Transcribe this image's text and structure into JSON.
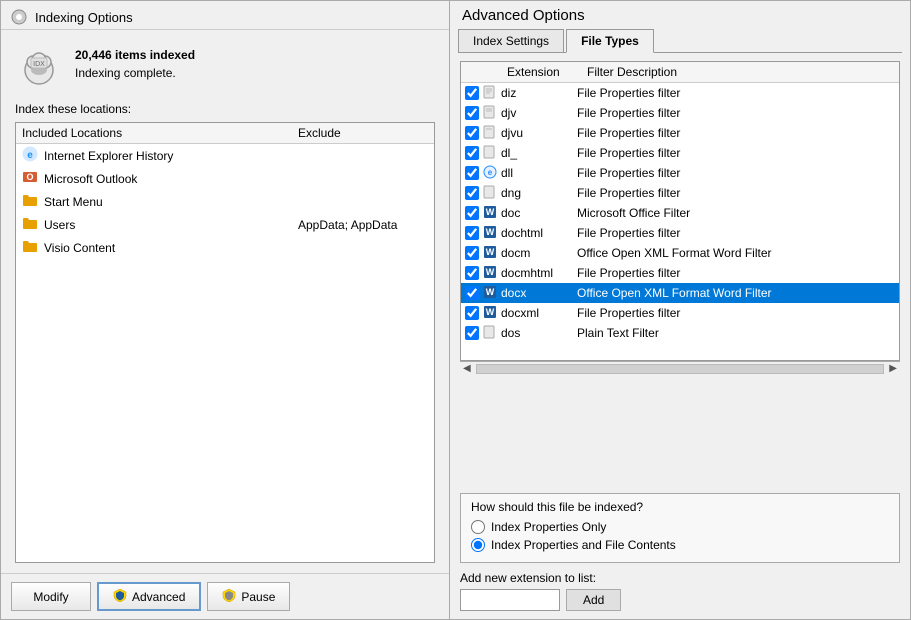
{
  "left": {
    "title": "Indexing Options",
    "items_indexed": "20,446 items indexed",
    "indexing_status": "Indexing complete.",
    "index_locations_label": "Index these locations:",
    "locations_header": {
      "col1": "Included Locations",
      "col2": "Exclude"
    },
    "locations": [
      {
        "name": "Internet Explorer History",
        "type": "ie",
        "exclude": ""
      },
      {
        "name": "Microsoft Outlook",
        "type": "outlook",
        "exclude": ""
      },
      {
        "name": "Start Menu",
        "type": "folder",
        "exclude": ""
      },
      {
        "name": "Users",
        "type": "folder",
        "exclude": "AppData; AppData"
      },
      {
        "name": "Visio Content",
        "type": "folder",
        "exclude": ""
      }
    ],
    "buttons": {
      "modify": "Modify",
      "advanced": "Advanced",
      "pause": "Pause"
    }
  },
  "right": {
    "title": "Advanced Options",
    "tabs": [
      {
        "label": "Index Settings",
        "active": false
      },
      {
        "label": "File Types",
        "active": true
      }
    ],
    "table_headers": {
      "extension": "Extension",
      "filter": "Filter Description"
    },
    "file_types": [
      {
        "checked": true,
        "icon": "generic",
        "ext": "diz",
        "filter": "File Properties filter",
        "selected": false
      },
      {
        "checked": true,
        "icon": "generic",
        "ext": "djv",
        "filter": "File Properties filter",
        "selected": false
      },
      {
        "checked": true,
        "icon": "generic",
        "ext": "djvu",
        "filter": "File Properties filter",
        "selected": false
      },
      {
        "checked": true,
        "icon": "generic",
        "ext": "dl_",
        "filter": "File Properties filter",
        "selected": false
      },
      {
        "checked": true,
        "icon": "ie",
        "ext": "dll",
        "filter": "File Properties filter",
        "selected": false
      },
      {
        "checked": true,
        "icon": "generic",
        "ext": "dng",
        "filter": "File Properties filter",
        "selected": false
      },
      {
        "checked": true,
        "icon": "word",
        "ext": "doc",
        "filter": "Microsoft Office Filter",
        "selected": false
      },
      {
        "checked": true,
        "icon": "word",
        "ext": "dochtml",
        "filter": "File Properties filter",
        "selected": false
      },
      {
        "checked": true,
        "icon": "word",
        "ext": "docm",
        "filter": "Office Open XML Format Word Filter",
        "selected": false
      },
      {
        "checked": true,
        "icon": "word",
        "ext": "docmhtml",
        "filter": "File Properties filter",
        "selected": false
      },
      {
        "checked": true,
        "icon": "word",
        "ext": "docx",
        "filter": "Office Open XML Format Word Filter",
        "selected": true
      },
      {
        "checked": true,
        "icon": "word",
        "ext": "docxml",
        "filter": "File Properties filter",
        "selected": false
      },
      {
        "checked": true,
        "icon": "generic",
        "ext": "dos",
        "filter": "Plain Text Filter",
        "selected": false
      }
    ],
    "indexing_section": {
      "title": "How should this file be indexed?",
      "options": [
        {
          "label": "Index Properties Only",
          "selected": false
        },
        {
          "label": "Index Properties and File Contents",
          "selected": true
        }
      ]
    },
    "add_extension": {
      "label": "Add new extension to list:",
      "placeholder": "",
      "button": "Add"
    }
  }
}
